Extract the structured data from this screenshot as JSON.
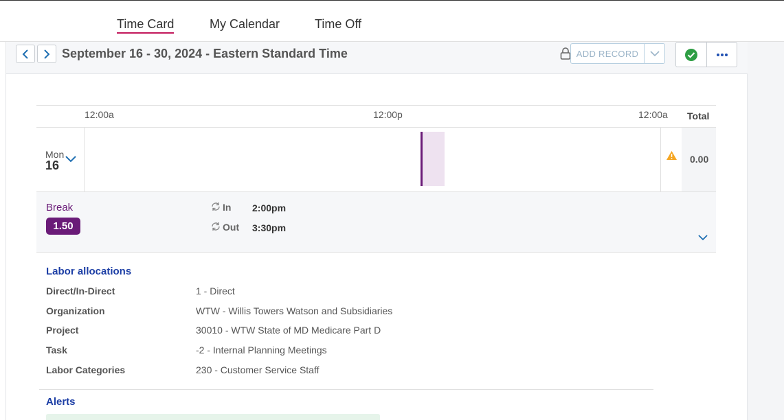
{
  "tabs": [
    {
      "label": "Time Card",
      "active": true
    },
    {
      "label": "My Calendar",
      "active": false
    },
    {
      "label": "Time Off",
      "active": false
    }
  ],
  "header": {
    "period": "September 16 - 30, 2024 - Eastern Standard Time",
    "add_record_label": "ADD RECORD"
  },
  "timeline": {
    "labels": [
      "12:00a",
      "12:00p",
      "12:00a"
    ],
    "total_label": "Total"
  },
  "day": {
    "dow": "Mon",
    "date": "16",
    "total": "0.00"
  },
  "entry": {
    "type": "Break",
    "hours": "1.50",
    "in_label": "In",
    "in_time": "2:00pm",
    "out_label": "Out",
    "out_time": "3:30pm"
  },
  "labor": {
    "title": "Labor allocations",
    "rows": [
      {
        "key": "Direct/In-Direct",
        "value": "1 - Direct"
      },
      {
        "key": "Organization",
        "value": "WTW - Willis Towers Watson and Subsidiaries"
      },
      {
        "key": "Project",
        "value": "30010 - WTW State of MD Medicare Part D"
      },
      {
        "key": "Task",
        "value": "-2 - Internal Planning Meetings"
      },
      {
        "key": "Labor Categories",
        "value": "230 - Customer Service Staff"
      }
    ]
  },
  "alerts": {
    "title": "Alerts"
  },
  "colors": {
    "accent_tab": "#c2185b",
    "break_purple": "#6a1b78",
    "section_blue": "#1c3ea5",
    "ok_green": "#2e9e44",
    "warn_orange": "#f5a623"
  },
  "icons": [
    "chevron-left-icon",
    "chevron-right-icon",
    "lock-icon",
    "chevron-down-icon",
    "check-circle-icon",
    "more-icon",
    "warning-icon",
    "sync-icon"
  ]
}
